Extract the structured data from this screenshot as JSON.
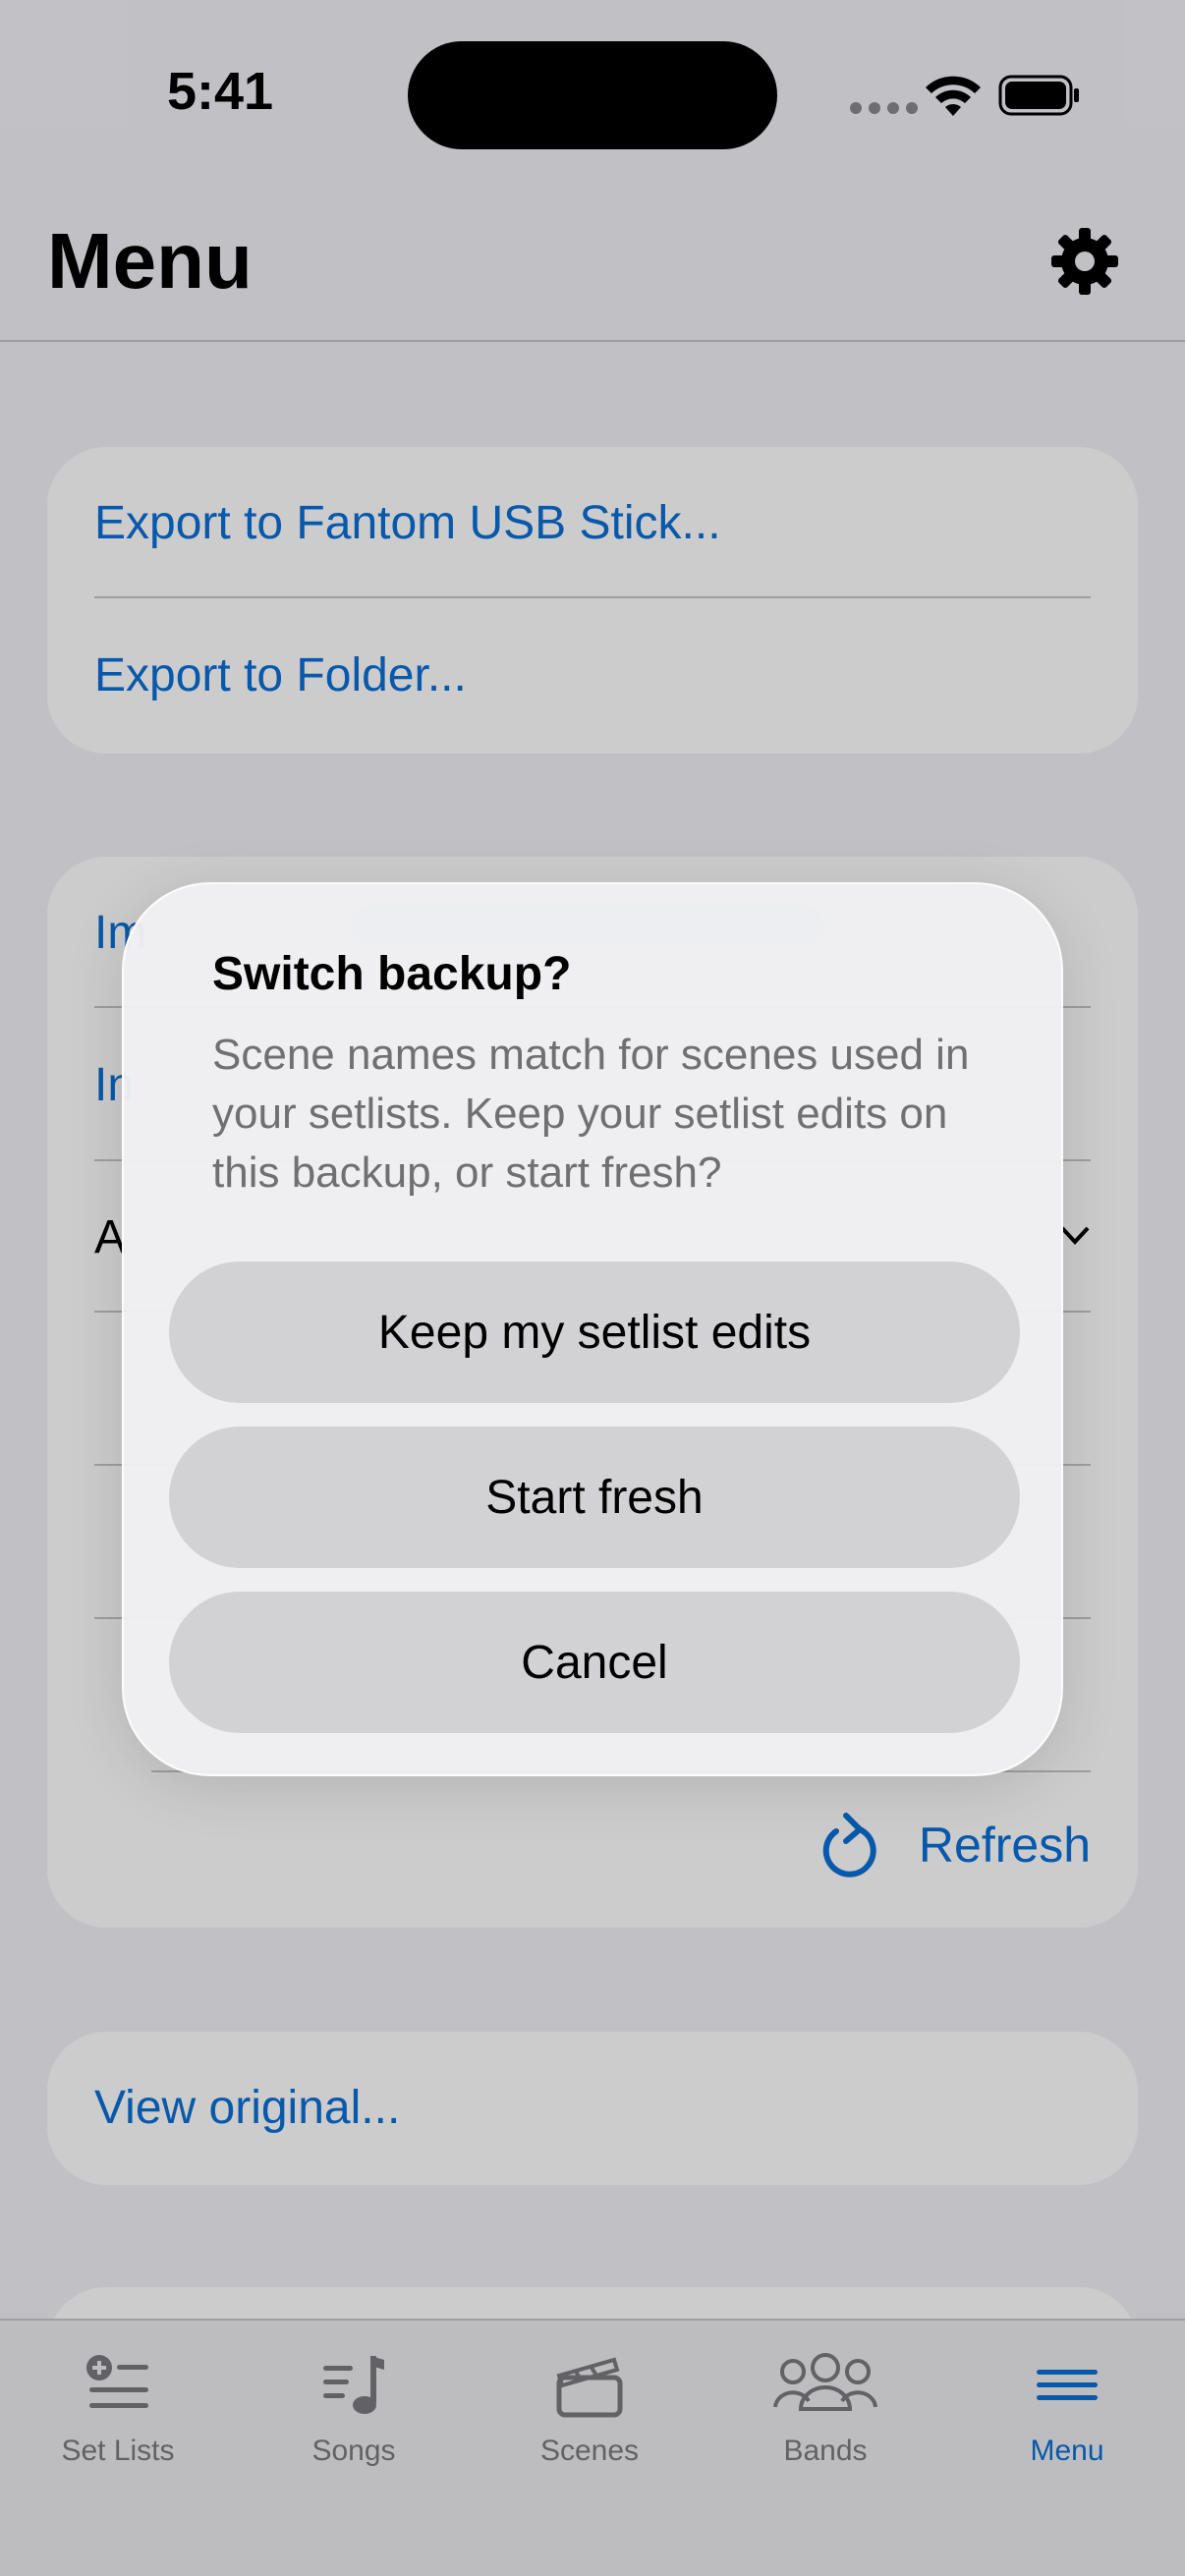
{
  "status": {
    "time": "5:41"
  },
  "nav": {
    "title": "Menu"
  },
  "export": {
    "items": [
      "Export to Fantom USB Stick...",
      "Export to Folder..."
    ]
  },
  "imports": {
    "partial_1": "Im",
    "partial_2": "In",
    "partial_3": "A",
    "refresh_label": "Refresh"
  },
  "view_original": "View original...",
  "dialog": {
    "title": "Switch backup?",
    "message": "Scene names match for scenes used in your setlists. Keep your setlist edits on this backup, or start fresh?",
    "buttons": [
      "Keep my setlist edits",
      "Start fresh",
      "Cancel"
    ]
  },
  "tabs": [
    {
      "label": "Set Lists",
      "icon": "setlist-icon"
    },
    {
      "label": "Songs",
      "icon": "music-note-icon"
    },
    {
      "label": "Scenes",
      "icon": "clapperboard-icon"
    },
    {
      "label": "Bands",
      "icon": "people-icon"
    },
    {
      "label": "Menu",
      "icon": "hamburger-icon",
      "active": true
    }
  ],
  "colors": {
    "accent": "#0a6fd6",
    "background": "#f2f2f7"
  }
}
